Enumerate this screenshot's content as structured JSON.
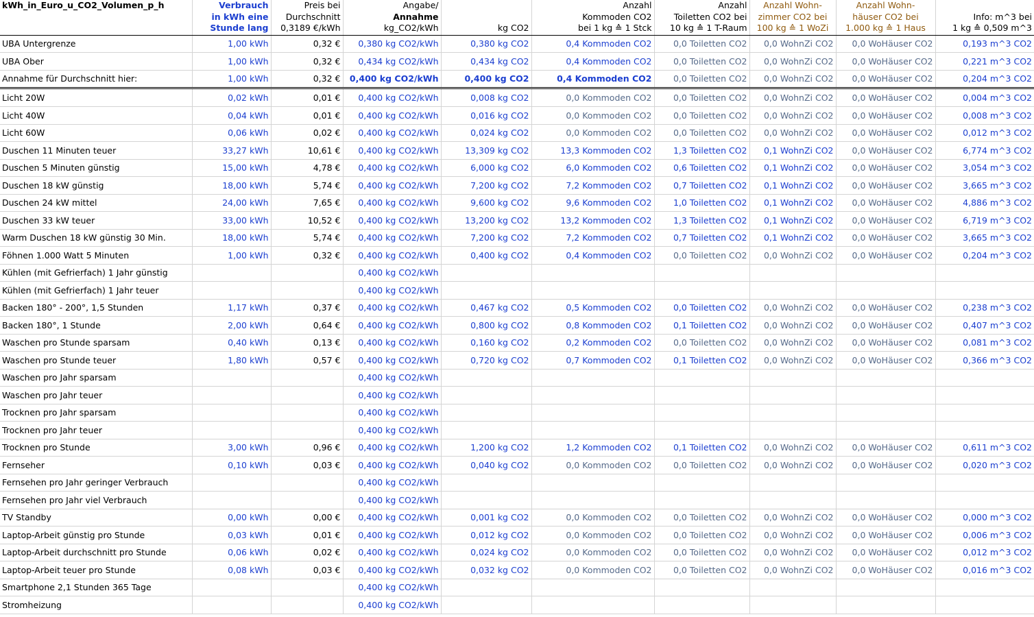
{
  "sheet": {
    "title": "kWh_in_Euro_u_CO2_Volumen_p_h",
    "headers": {
      "verbrauch": [
        "Verbrauch",
        "in kWh eine",
        "Stunde lang"
      ],
      "preis": [
        "Preis bei",
        "Durchschnitt",
        "0,3189 €/kWh"
      ],
      "angabe": [
        "Angabe/",
        "Annahme",
        "kg_CO2/kWh"
      ],
      "kgco2": [
        "",
        "",
        "kg CO2"
      ],
      "kommoden": [
        "Anzahl",
        "Kommoden CO2",
        "bei 1 kg ≙ 1 Stck"
      ],
      "toiletten": [
        "Anzahl",
        "Toiletten CO2 bei",
        "10 kg ≙ 1 T-Raum"
      ],
      "wohnzi": [
        "Anzahl Wohn-",
        "zimmer CO2 bei",
        "100 kg ≙ 1 WoZi"
      ],
      "wohnhaeuser": [
        "Anzahl Wohn-",
        "häuser CO2 bei",
        "1.000 kg ≙ 1 Haus"
      ],
      "info": [
        "",
        "Info: m^3 bei",
        "1 kg ≙ 0,509 m^3"
      ]
    },
    "colors": {
      "blue": "#1c3fd0",
      "slate": "#566a8a",
      "olive": "#8f5a0e"
    },
    "rows": [
      {
        "label": "UBA Untergrenze",
        "kwh": "1,00 kWh",
        "preis": "0,32 €",
        "angabe": "0,380 kg CO2/kWh",
        "kg": "0,380 kg CO2",
        "kommoden": "0,4 Kommoden CO2",
        "kommoden_blue": true,
        "toiletten": "0,0 Toiletten CO2",
        "toiletten_blue": false,
        "wohnzi": "0,0 WohnZi CO2",
        "wohnzi_blue": false,
        "haus": "0,0 WoHäuser CO2",
        "m3": "0,193 m^3 CO2"
      },
      {
        "label": "UBA Ober",
        "kwh": "1,00 kWh",
        "preis": "0,32 €",
        "angabe": "0,434 kg CO2/kWh",
        "kg": "0,434 kg CO2",
        "kommoden": "0,4 Kommoden CO2",
        "kommoden_blue": true,
        "toiletten": "0,0 Toiletten CO2",
        "toiletten_blue": false,
        "wohnzi": "0,0 WohnZi CO2",
        "wohnzi_blue": false,
        "haus": "0,0 WoHäuser CO2",
        "m3": "0,221 m^3 CO2"
      },
      {
        "label": "Annahme für Durchschnitt hier:",
        "kwh": "1,00 kWh",
        "preis": "0,32 €",
        "angabe": "0,400 kg CO2/kWh",
        "kg": "0,400 kg CO2",
        "kommoden": "0,4 Kommoden CO2",
        "kommoden_blue": true,
        "toiletten": "0,0 Toiletten CO2",
        "toiletten_blue": false,
        "wohnzi": "0,0 WohnZi CO2",
        "wohnzi_blue": false,
        "haus": "0,0 WoHäuser CO2",
        "m3": "0,204 m^3 CO2",
        "bold": true,
        "separator_after": true
      },
      {
        "label": "Licht  20W",
        "kwh": "0,02 kWh",
        "preis": "0,01 €",
        "angabe": "0,400 kg CO2/kWh",
        "kg": "0,008 kg CO2",
        "kommoden": "0,0 Kommoden CO2",
        "kommoden_blue": false,
        "toiletten": "0,0 Toiletten CO2",
        "toiletten_blue": false,
        "wohnzi": "0,0 WohnZi CO2",
        "wohnzi_blue": false,
        "haus": "0,0 WoHäuser CO2",
        "m3": "0,004 m^3 CO2"
      },
      {
        "label": "Licht  40W",
        "kwh": "0,04 kWh",
        "preis": "0,01 €",
        "angabe": "0,400 kg CO2/kWh",
        "kg": "0,016 kg CO2",
        "kommoden": "0,0 Kommoden CO2",
        "kommoden_blue": false,
        "toiletten": "0,0 Toiletten CO2",
        "toiletten_blue": false,
        "wohnzi": "0,0 WohnZi CO2",
        "wohnzi_blue": false,
        "haus": "0,0 WoHäuser CO2",
        "m3": "0,008 m^3 CO2"
      },
      {
        "label": "Licht  60W",
        "kwh": "0,06 kWh",
        "preis": "0,02 €",
        "angabe": "0,400 kg CO2/kWh",
        "kg": "0,024 kg CO2",
        "kommoden": "0,0 Kommoden CO2",
        "kommoden_blue": false,
        "toiletten": "0,0 Toiletten CO2",
        "toiletten_blue": false,
        "wohnzi": "0,0 WohnZi CO2",
        "wohnzi_blue": false,
        "haus": "0,0 WoHäuser CO2",
        "m3": "0,012 m^3 CO2"
      },
      {
        "label": "Duschen 11 Minuten teuer",
        "kwh": "33,27 kWh",
        "preis": "10,61 €",
        "angabe": "0,400 kg CO2/kWh",
        "kg": "13,309 kg CO2",
        "kommoden": "13,3 Kommoden CO2",
        "kommoden_blue": true,
        "toiletten": "1,3 Toiletten CO2",
        "toiletten_blue": true,
        "wohnzi": "0,1 WohnZi CO2",
        "wohnzi_blue": true,
        "haus": "0,0 WoHäuser CO2",
        "m3": "6,774 m^3 CO2"
      },
      {
        "label": "Duschen 5 Minuten günstig",
        "kwh": "15,00 kWh",
        "preis": "4,78 €",
        "angabe": "0,400 kg CO2/kWh",
        "kg": "6,000 kg CO2",
        "kommoden": "6,0 Kommoden CO2",
        "kommoden_blue": true,
        "toiletten": "0,6 Toiletten CO2",
        "toiletten_blue": true,
        "wohnzi": "0,1 WohnZi CO2",
        "wohnzi_blue": true,
        "haus": "0,0 WoHäuser CO2",
        "m3": "3,054 m^3 CO2"
      },
      {
        "label": "Duschen 18 kW günstig",
        "kwh": "18,00 kWh",
        "preis": "5,74 €",
        "angabe": "0,400 kg CO2/kWh",
        "kg": "7,200 kg CO2",
        "kommoden": "7,2 Kommoden CO2",
        "kommoden_blue": true,
        "toiletten": "0,7 Toiletten CO2",
        "toiletten_blue": true,
        "wohnzi": "0,1 WohnZi CO2",
        "wohnzi_blue": true,
        "haus": "0,0 WoHäuser CO2",
        "m3": "3,665 m^3 CO2"
      },
      {
        "label": "Duschen 24 kW mittel",
        "kwh": "24,00 kWh",
        "preis": "7,65 €",
        "angabe": "0,400 kg CO2/kWh",
        "kg": "9,600 kg CO2",
        "kommoden": "9,6 Kommoden CO2",
        "kommoden_blue": true,
        "toiletten": "1,0 Toiletten CO2",
        "toiletten_blue": true,
        "wohnzi": "0,1 WohnZi CO2",
        "wohnzi_blue": true,
        "haus": "0,0 WoHäuser CO2",
        "m3": "4,886 m^3 CO2"
      },
      {
        "label": "Duschen 33 kW teuer",
        "kwh": "33,00 kWh",
        "preis": "10,52 €",
        "angabe": "0,400 kg CO2/kWh",
        "kg": "13,200 kg CO2",
        "kommoden": "13,2 Kommoden CO2",
        "kommoden_blue": true,
        "toiletten": "1,3 Toiletten CO2",
        "toiletten_blue": true,
        "wohnzi": "0,1 WohnZi CO2",
        "wohnzi_blue": true,
        "haus": "0,0 WoHäuser CO2",
        "m3": "6,719 m^3 CO2"
      },
      {
        "label": "Warm Duschen 18 kW günstig  30 Min.",
        "kwh": "18,00 kWh",
        "preis": "5,74 €",
        "angabe": "0,400 kg CO2/kWh",
        "kg": "7,200 kg CO2",
        "kommoden": "7,2 Kommoden CO2",
        "kommoden_blue": true,
        "toiletten": "0,7 Toiletten CO2",
        "toiletten_blue": true,
        "wohnzi": "0,1 WohnZi CO2",
        "wohnzi_blue": true,
        "haus": "0,0 WoHäuser CO2",
        "m3": "3,665 m^3 CO2"
      },
      {
        "label": "Föhnen 1.000 Watt 5 Minuten",
        "kwh": "1,00 kWh",
        "preis": "0,32 €",
        "angabe": "0,400 kg CO2/kWh",
        "kg": "0,400 kg CO2",
        "kommoden": "0,4 Kommoden CO2",
        "kommoden_blue": true,
        "toiletten": "0,0 Toiletten CO2",
        "toiletten_blue": false,
        "wohnzi": "0,0 WohnZi CO2",
        "wohnzi_blue": false,
        "haus": "0,0 WoHäuser CO2",
        "m3": "0,204 m^3 CO2"
      },
      {
        "label": "Kühlen (mit Gefrierfach) 1 Jahr günstig",
        "kwh": "",
        "preis": "",
        "angabe": "0,400 kg CO2/kWh",
        "kg": "",
        "kommoden": "",
        "kommoden_blue": false,
        "toiletten": "",
        "toiletten_blue": false,
        "wohnzi": "",
        "wohnzi_blue": false,
        "haus": "",
        "m3": ""
      },
      {
        "label": "Kühlen (mit Gefrierfach) 1 Jahr teuer",
        "kwh": "",
        "preis": "",
        "angabe": "0,400 kg CO2/kWh",
        "kg": "",
        "kommoden": "",
        "kommoden_blue": false,
        "toiletten": "",
        "toiletten_blue": false,
        "wohnzi": "",
        "wohnzi_blue": false,
        "haus": "",
        "m3": ""
      },
      {
        "label": "Backen 180° - 200°, 1,5 Stunden",
        "kwh": "1,17 kWh",
        "preis": "0,37 €",
        "angabe": "0,400 kg CO2/kWh",
        "kg": "0,467 kg CO2",
        "kommoden": "0,5 Kommoden CO2",
        "kommoden_blue": true,
        "toiletten": "0,0 Toiletten CO2",
        "toiletten_blue": true,
        "wohnzi": "0,0 WohnZi CO2",
        "wohnzi_blue": false,
        "haus": "0,0 WoHäuser CO2",
        "m3": "0,238 m^3 CO2"
      },
      {
        "label": "Backen 180°, 1 Stunde",
        "kwh": "2,00 kWh",
        "preis": "0,64 €",
        "angabe": "0,400 kg CO2/kWh",
        "kg": "0,800 kg CO2",
        "kommoden": "0,8 Kommoden CO2",
        "kommoden_blue": true,
        "toiletten": "0,1 Toiletten CO2",
        "toiletten_blue": true,
        "wohnzi": "0,0 WohnZi CO2",
        "wohnzi_blue": false,
        "haus": "0,0 WoHäuser CO2",
        "m3": "0,407 m^3 CO2"
      },
      {
        "label": "Waschen pro Stunde sparsam",
        "kwh": "0,40 kWh",
        "preis": "0,13 €",
        "angabe": "0,400 kg CO2/kWh",
        "kg": "0,160 kg CO2",
        "kommoden": "0,2 Kommoden CO2",
        "kommoden_blue": true,
        "toiletten": "0,0 Toiletten CO2",
        "toiletten_blue": false,
        "wohnzi": "0,0 WohnZi CO2",
        "wohnzi_blue": false,
        "haus": "0,0 WoHäuser CO2",
        "m3": "0,081 m^3 CO2"
      },
      {
        "label": "Waschen pro Stunde teuer",
        "kwh": "1,80 kWh",
        "preis": "0,57 €",
        "angabe": "0,400 kg CO2/kWh",
        "kg": "0,720 kg CO2",
        "kommoden": "0,7 Kommoden CO2",
        "kommoden_blue": true,
        "toiletten": "0,1 Toiletten CO2",
        "toiletten_blue": true,
        "wohnzi": "0,0 WohnZi CO2",
        "wohnzi_blue": false,
        "haus": "0,0 WoHäuser CO2",
        "m3": "0,366 m^3 CO2"
      },
      {
        "label": "Waschen pro Jahr sparsam",
        "kwh": "",
        "preis": "",
        "angabe": "0,400 kg CO2/kWh",
        "kg": "",
        "kommoden": "",
        "kommoden_blue": false,
        "toiletten": "",
        "toiletten_blue": false,
        "wohnzi": "",
        "wohnzi_blue": false,
        "haus": "",
        "m3": ""
      },
      {
        "label": "Waschen pro Jahr teuer",
        "kwh": "",
        "preis": "",
        "angabe": "0,400 kg CO2/kWh",
        "kg": "",
        "kommoden": "",
        "kommoden_blue": false,
        "toiletten": "",
        "toiletten_blue": false,
        "wohnzi": "",
        "wohnzi_blue": false,
        "haus": "",
        "m3": ""
      },
      {
        "label": "Trocknen pro Jahr sparsam",
        "kwh": "",
        "preis": "",
        "angabe": "0,400 kg CO2/kWh",
        "kg": "",
        "kommoden": "",
        "kommoden_blue": false,
        "toiletten": "",
        "toiletten_blue": false,
        "wohnzi": "",
        "wohnzi_blue": false,
        "haus": "",
        "m3": ""
      },
      {
        "label": "Trocknen pro Jahr teuer",
        "kwh": "",
        "preis": "",
        "angabe": "0,400 kg CO2/kWh",
        "kg": "",
        "kommoden": "",
        "kommoden_blue": false,
        "toiletten": "",
        "toiletten_blue": false,
        "wohnzi": "",
        "wohnzi_blue": false,
        "haus": "",
        "m3": ""
      },
      {
        "label": "Trocknen pro Stunde",
        "kwh": "3,00 kWh",
        "preis": "0,96 €",
        "angabe": "0,400 kg CO2/kWh",
        "kg": "1,200 kg CO2",
        "kommoden": "1,2 Kommoden CO2",
        "kommoden_blue": true,
        "toiletten": "0,1 Toiletten CO2",
        "toiletten_blue": true,
        "wohnzi": "0,0 WohnZi CO2",
        "wohnzi_blue": false,
        "haus": "0,0 WoHäuser CO2",
        "m3": "0,611 m^3 CO2"
      },
      {
        "label": "Fernseher",
        "kwh": "0,10 kWh",
        "preis": "0,03 €",
        "angabe": "0,400 kg CO2/kWh",
        "kg": "0,040 kg CO2",
        "kommoden": "0,0 Kommoden CO2",
        "kommoden_blue": false,
        "toiletten": "0,0 Toiletten CO2",
        "toiletten_blue": false,
        "wohnzi": "0,0 WohnZi CO2",
        "wohnzi_blue": false,
        "haus": "0,0 WoHäuser CO2",
        "m3": "0,020 m^3 CO2"
      },
      {
        "label": "Fernsehen pro Jahr geringer Verbrauch",
        "kwh": "",
        "preis": "",
        "angabe": "0,400 kg CO2/kWh",
        "kg": "",
        "kommoden": "",
        "kommoden_blue": false,
        "toiletten": "",
        "toiletten_blue": false,
        "wohnzi": "",
        "wohnzi_blue": false,
        "haus": "",
        "m3": ""
      },
      {
        "label": "Fernsehen pro Jahr viel Verbrauch",
        "kwh": "",
        "preis": "",
        "angabe": "0,400 kg CO2/kWh",
        "kg": "",
        "kommoden": "",
        "kommoden_blue": false,
        "toiletten": "",
        "toiletten_blue": false,
        "wohnzi": "",
        "wohnzi_blue": false,
        "haus": "",
        "m3": ""
      },
      {
        "label": "TV Standby",
        "kwh": "0,00 kWh",
        "preis": "0,00 €",
        "angabe": "0,400 kg CO2/kWh",
        "kg": "0,001 kg CO2",
        "kommoden": "0,0 Kommoden CO2",
        "kommoden_blue": false,
        "toiletten": "0,0 Toiletten CO2",
        "toiletten_blue": false,
        "wohnzi": "0,0 WohnZi CO2",
        "wohnzi_blue": false,
        "haus": "0,0 WoHäuser CO2",
        "m3": "0,000 m^3 CO2"
      },
      {
        "label": "Laptop-Arbeit günstig pro Stunde",
        "kwh": "0,03 kWh",
        "preis": "0,01 €",
        "angabe": "0,400 kg CO2/kWh",
        "kg": "0,012 kg CO2",
        "kommoden": "0,0 Kommoden CO2",
        "kommoden_blue": false,
        "toiletten": "0,0 Toiletten CO2",
        "toiletten_blue": false,
        "wohnzi": "0,0 WohnZi CO2",
        "wohnzi_blue": false,
        "haus": "0,0 WoHäuser CO2",
        "m3": "0,006 m^3 CO2"
      },
      {
        "label": "Laptop-Arbeit durchschnitt pro Stunde",
        "kwh": "0,06 kWh",
        "preis": "0,02 €",
        "angabe": "0,400 kg CO2/kWh",
        "kg": "0,024 kg CO2",
        "kommoden": "0,0 Kommoden CO2",
        "kommoden_blue": false,
        "toiletten": "0,0 Toiletten CO2",
        "toiletten_blue": false,
        "wohnzi": "0,0 WohnZi CO2",
        "wohnzi_blue": false,
        "haus": "0,0 WoHäuser CO2",
        "m3": "0,012 m^3 CO2"
      },
      {
        "label": "Laptop-Arbeit teuer pro Stunde",
        "kwh": "0,08 kWh",
        "preis": "0,03 €",
        "angabe": "0,400 kg CO2/kWh",
        "kg": "0,032 kg CO2",
        "kommoden": "0,0 Kommoden CO2",
        "kommoden_blue": false,
        "toiletten": "0,0 Toiletten CO2",
        "toiletten_blue": false,
        "wohnzi": "0,0 WohnZi CO2",
        "wohnzi_blue": false,
        "haus": "0,0 WoHäuser CO2",
        "m3": "0,016 m^3 CO2"
      },
      {
        "label": "Smartphone 2,1 Stunden 365 Tage",
        "kwh": "",
        "preis": "",
        "angabe": "0,400 kg CO2/kWh",
        "kg": "",
        "kommoden": "",
        "kommoden_blue": false,
        "toiletten": "",
        "toiletten_blue": false,
        "wohnzi": "",
        "wohnzi_blue": false,
        "haus": "",
        "m3": ""
      },
      {
        "label": "Stromheizung",
        "kwh": "",
        "preis": "",
        "angabe": "0,400 kg CO2/kWh",
        "kg": "",
        "kommoden": "",
        "kommoden_blue": false,
        "toiletten": "",
        "toiletten_blue": false,
        "wohnzi": "",
        "wohnzi_blue": false,
        "haus": "",
        "m3": ""
      }
    ]
  }
}
